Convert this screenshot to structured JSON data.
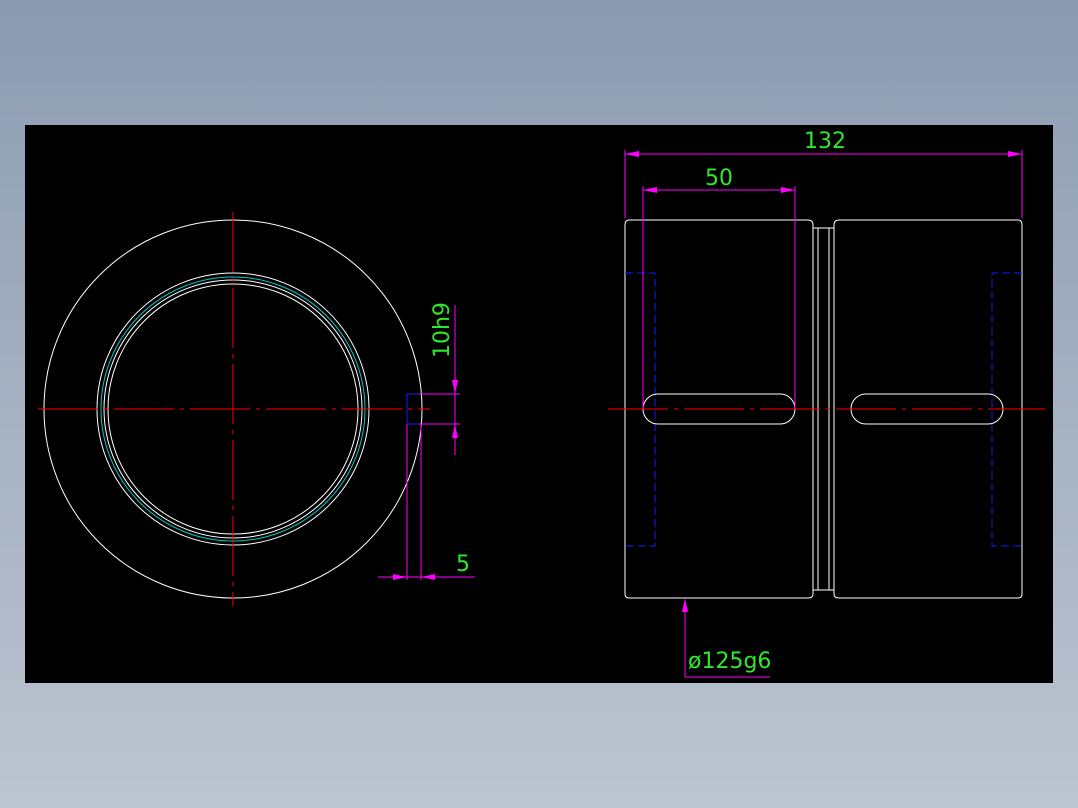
{
  "colors": {
    "background_top": "#8b9bb0",
    "background_bottom": "#bcc4d0",
    "drawing_area": "#000000",
    "outline": "#ffffff",
    "center_line": "#ff0000",
    "dimension": "#ff00ff",
    "dimension_text": "#2ee82e",
    "hidden_line": "#1a1aff",
    "thread": "#00c8c8"
  },
  "dimensions": {
    "overall_length": "132",
    "slot_length": "50",
    "key_width": "10h9",
    "key_depth": "5",
    "outer_diameter": "ø125g6"
  }
}
